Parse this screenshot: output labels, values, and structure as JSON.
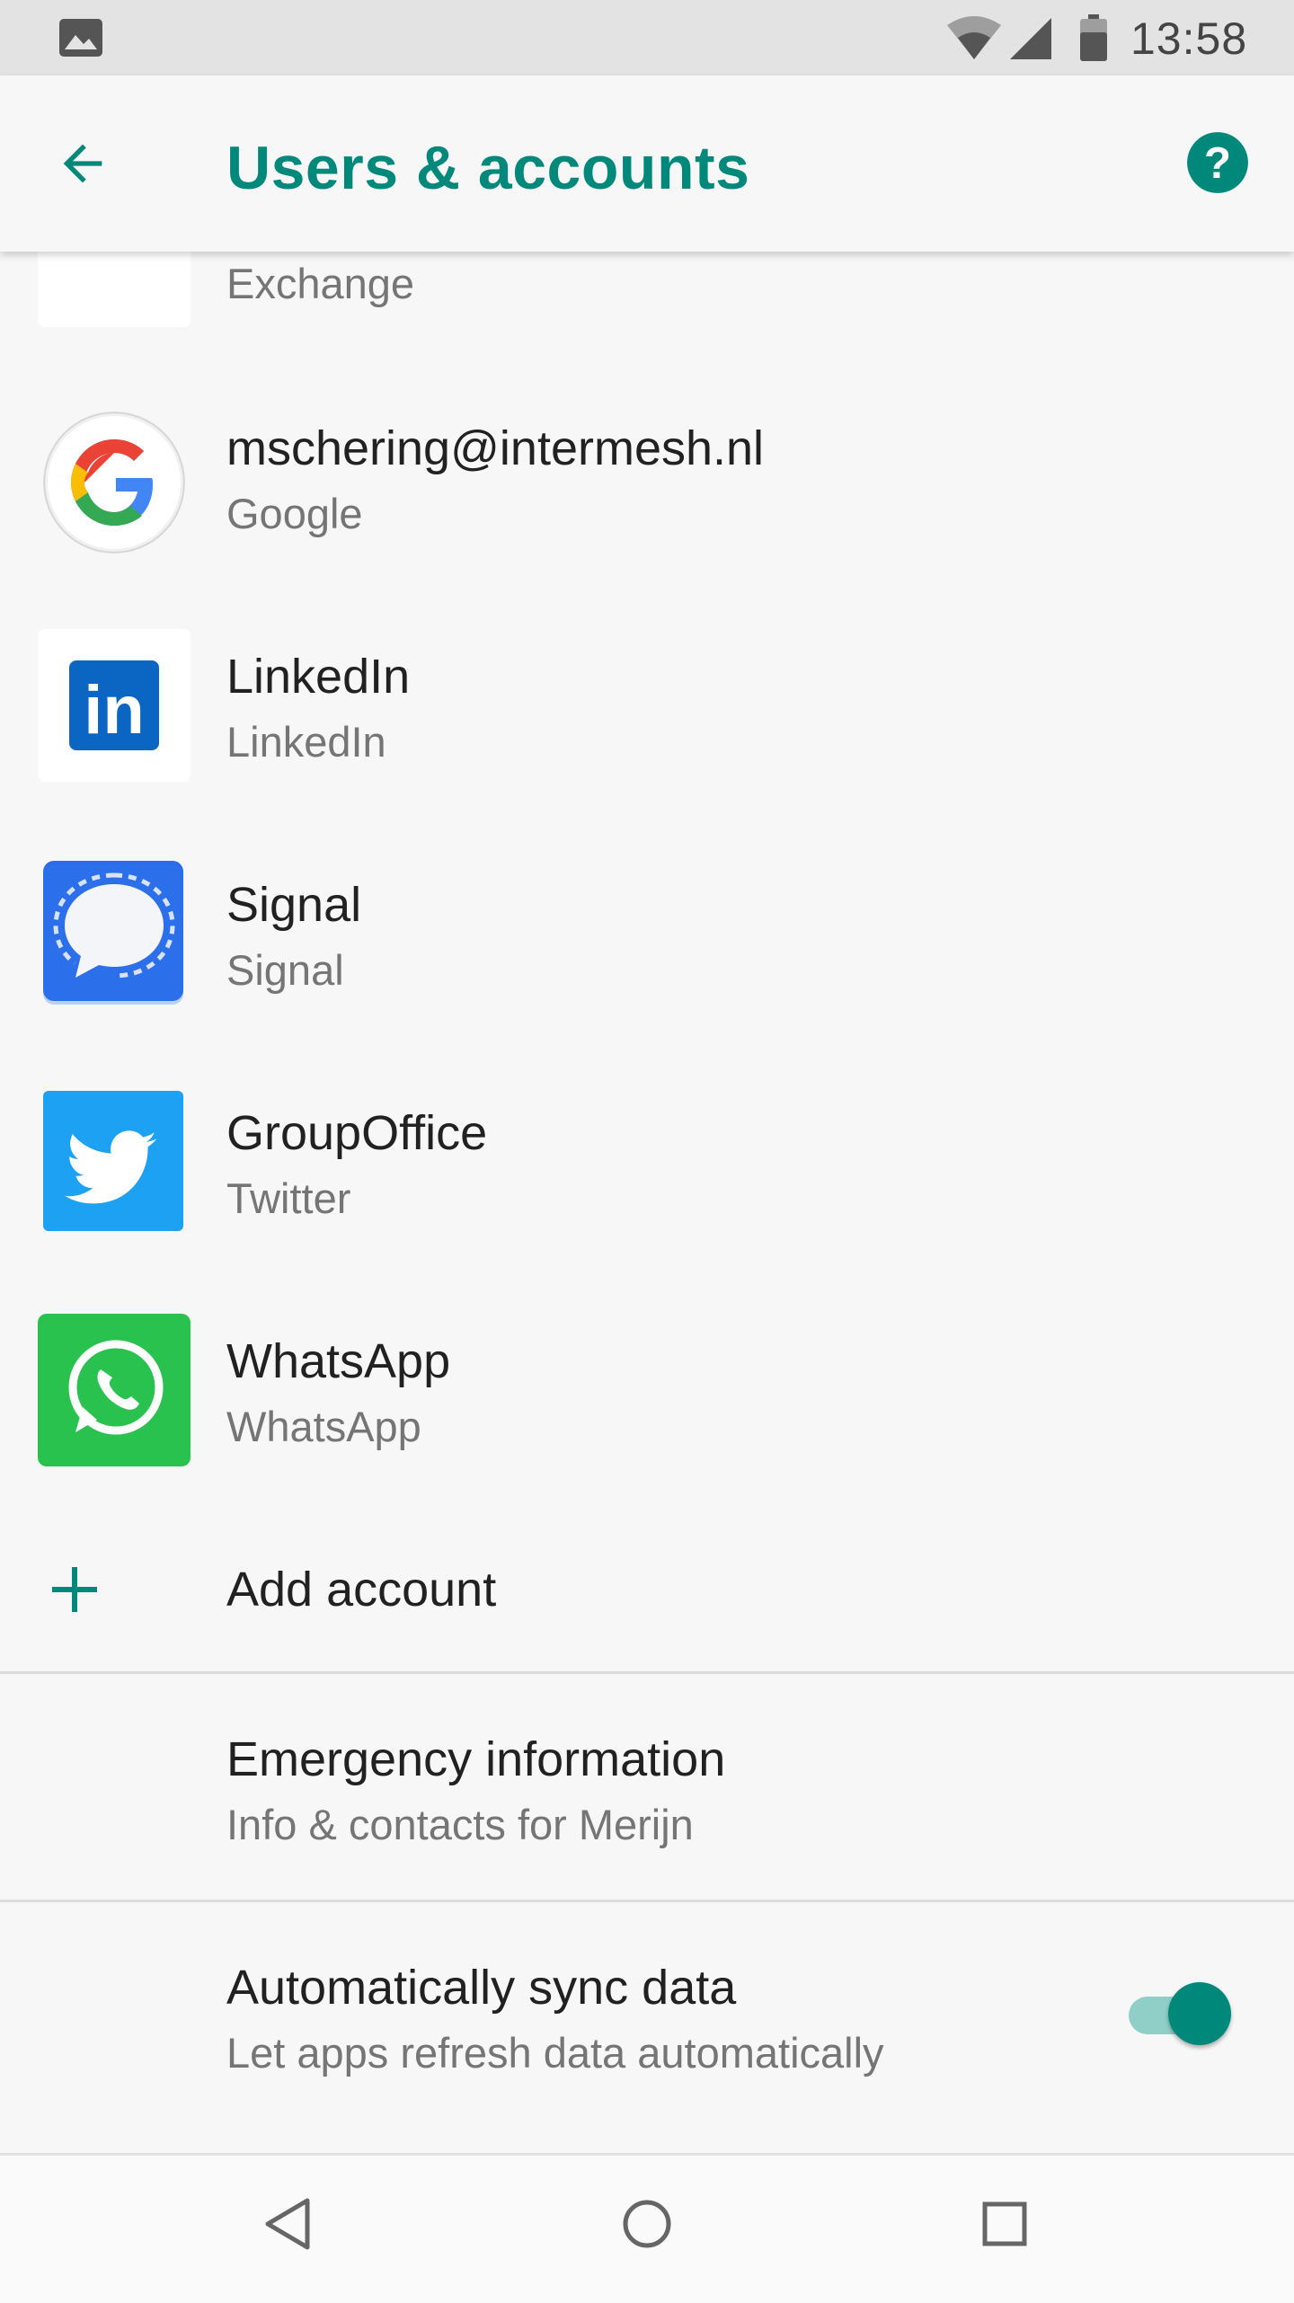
{
  "status_bar": {
    "time": "13:58",
    "icons": [
      "gallery-icon",
      "wifi-icon",
      "signal-icon",
      "battery-icon"
    ]
  },
  "app_bar": {
    "title": "Users & accounts",
    "back_icon": "arrow-back-icon",
    "help_icon": "help-icon"
  },
  "accounts": [
    {
      "primary": "",
      "secondary": "Exchange",
      "icon": "gmail-icon"
    },
    {
      "primary": "mschering@intermesh.nl",
      "secondary": "Google",
      "icon": "google-icon"
    },
    {
      "primary": "LinkedIn",
      "secondary": "LinkedIn",
      "icon": "linkedin-icon"
    },
    {
      "primary": "Signal",
      "secondary": "Signal",
      "icon": "signal-app-icon"
    },
    {
      "primary": "GroupOffice",
      "secondary": "Twitter",
      "icon": "twitter-icon"
    },
    {
      "primary": "WhatsApp",
      "secondary": "WhatsApp",
      "icon": "whatsapp-icon"
    }
  ],
  "add_account": {
    "label": "Add account",
    "icon": "plus-icon"
  },
  "emergency": {
    "primary": "Emergency information",
    "secondary": "Info & contacts for Merijn"
  },
  "auto_sync": {
    "primary": "Automatically sync data",
    "secondary": "Let apps refresh data automatically",
    "enabled": true
  },
  "colors": {
    "accent": "#00897b",
    "background": "#f7f7f7"
  },
  "nav_bar": {
    "icons": [
      "back-nav-icon",
      "home-nav-icon",
      "recents-nav-icon"
    ]
  }
}
